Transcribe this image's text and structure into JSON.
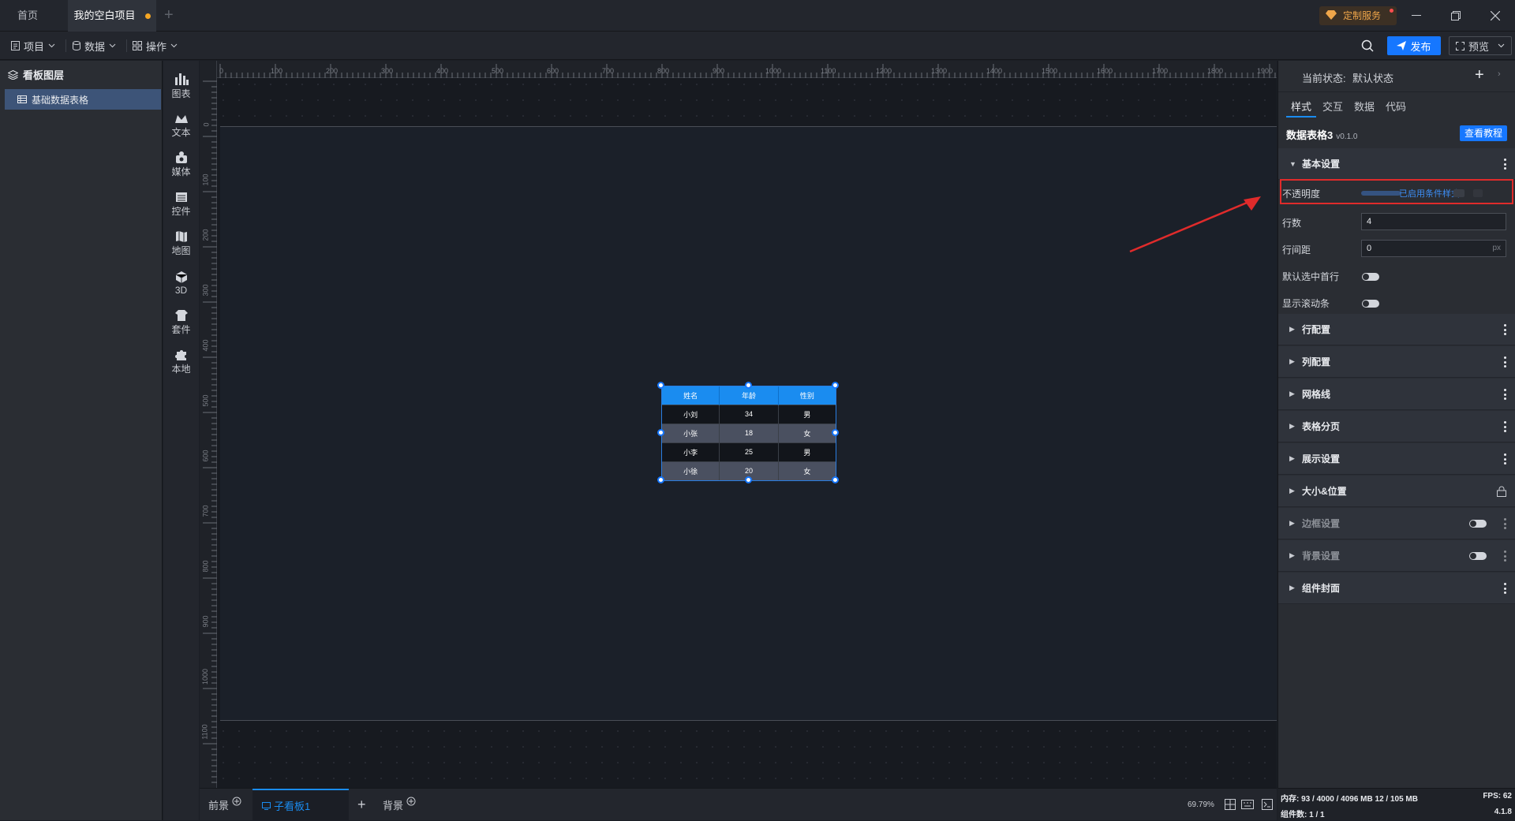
{
  "titlebar": {
    "tabs": [
      {
        "label": "首页"
      },
      {
        "label": "我的空白项目"
      }
    ],
    "custom_service": "定制服务"
  },
  "menubar": {
    "items": [
      {
        "label": "项目"
      },
      {
        "label": "数据"
      },
      {
        "label": "操作"
      }
    ],
    "publish": "发布",
    "preview": "预览"
  },
  "layers": {
    "title": "看板图层",
    "items": [
      {
        "label": "基础数据表格"
      }
    ]
  },
  "toolbar": {
    "tools": [
      {
        "label": "图表",
        "icon": "bar-chart-icon"
      },
      {
        "label": "文本",
        "icon": "text-icon"
      },
      {
        "label": "媒体",
        "icon": "media-icon"
      },
      {
        "label": "控件",
        "icon": "control-icon"
      },
      {
        "label": "地图",
        "icon": "map-icon"
      },
      {
        "label": "3D",
        "icon": "cube-icon"
      },
      {
        "label": "套件",
        "icon": "kit-icon"
      },
      {
        "label": "本地",
        "icon": "puzzle-icon"
      }
    ]
  },
  "canvas": {
    "ruler_top": [
      "0",
      "100",
      "200",
      "300",
      "400",
      "500",
      "600",
      "700",
      "800",
      "900",
      "1000",
      "1100",
      "1200",
      "1300",
      "1400",
      "1500",
      "1600",
      "1700",
      "1800",
      "1900"
    ],
    "ruler_left": [
      "0",
      "100",
      "200",
      "300",
      "400",
      "500",
      "600",
      "700",
      "800",
      "900",
      "1000",
      "1100"
    ],
    "table": {
      "headers": [
        "姓名",
        "年龄",
        "性别"
      ],
      "rows": [
        [
          "小刘",
          "34",
          "男"
        ],
        [
          "小张",
          "18",
          "女"
        ],
        [
          "小李",
          "25",
          "男"
        ],
        [
          "小徐",
          "20",
          "女"
        ]
      ]
    }
  },
  "bottombar": {
    "foreground": "前景",
    "sub_board": "子看板1",
    "background": "背景",
    "zoom": "69.79%"
  },
  "rightpanel": {
    "state_label": "当前状态:",
    "state_value": "默认状态",
    "tabs": [
      "样式",
      "交互",
      "数据",
      "代码"
    ],
    "component_name": "数据表格3",
    "component_version": "v0.1.0",
    "tutorial": "查看教程",
    "basic_section": "基本设置",
    "props": {
      "opacity_label": "不透明度",
      "opacity_note": "已启用条件样式",
      "rows_label": "行数",
      "rows_value": "4",
      "row_spacing_label": "行间距",
      "row_spacing_value": "0",
      "row_spacing_unit": "px",
      "select_first_label": "默认选中首行",
      "show_scroll_label": "显示滚动条"
    },
    "sections": [
      "行配置",
      "列配置",
      "网格线",
      "表格分页",
      "展示设置",
      "大小&位置",
      "边框设置",
      "背景设置",
      "组件封面"
    ]
  },
  "status": {
    "memory": "内存: 93 / 4000 / 4096 MB  12 / 105 MB",
    "fps": "FPS: 62",
    "components": "组件数: 1 / 1",
    "version": "4.1.8"
  },
  "colors": {
    "accent": "#1677ff",
    "highlight": "#e02b2b",
    "table_header": "#1a8cf0"
  }
}
